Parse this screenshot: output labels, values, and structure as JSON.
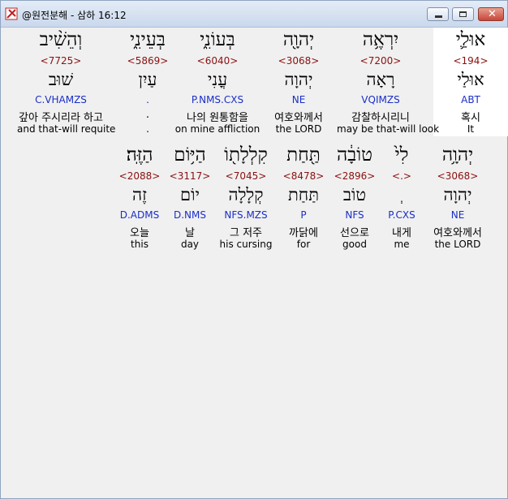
{
  "window": {
    "title": "@원전분해 - 삼하 16:12",
    "icon": "app-logo-icon",
    "controls": [
      "minimize-icon",
      "maximize-icon",
      "close-icon"
    ],
    "close_glyph": "✕"
  },
  "rows": [
    [
      {
        "heb": "אוּלַ֛י",
        "strong": "<194>",
        "lemma": "אוּלַי",
        "morph": "ABT",
        "kor": "혹시",
        "eng": "It",
        "highlight": true
      },
      {
        "heb": "יִרְאֶ֥ה",
        "strong": "<7200>",
        "lemma": "רָאָה",
        "morph": "VQIMZS",
        "kor": "감찰하시리니",
        "eng": "may be that-will look"
      },
      {
        "heb": "יְהוָ֖ה",
        "strong": "<3068>",
        "lemma": "יְהוָה",
        "morph": "NE",
        "kor": "여호와께서",
        "eng": "the LORD"
      },
      {
        "heb": "בְּעוֹנִ֑י",
        "strong": "<6040>",
        "lemma": "עֳנִי",
        "morph": "P.NMS.CXS",
        "kor": "나의 원통함을",
        "eng": "on mine affliction"
      },
      {
        "heb": "בְּעֵינִ֑י",
        "strong": "<5869>",
        "lemma": "עַיִן",
        "morph": ".",
        "kor": ".",
        "eng": "."
      },
      {
        "heb": "וְהֵשִׁ֨יב",
        "strong": "<7725>",
        "lemma": "שׁוּב",
        "morph": "C.VHAMZS",
        "kor": "갚아 주시리라 하고",
        "eng": "and that-will requite"
      }
    ],
    [
      {
        "heb": "יְהוָ֥ה",
        "strong": "<3068>",
        "lemma": "יְהוָה",
        "morph": "NE",
        "kor": "여호와께서",
        "eng": "the LORD"
      },
      {
        "heb": "לִי֙",
        "strong": "<.>",
        "lemma": "ְ",
        "morph": "P.CXS",
        "kor": "내게",
        "eng": "me"
      },
      {
        "heb": "טוֹבָ֔ה",
        "strong": "<2896>",
        "lemma": "טוֹב",
        "morph": "NFS",
        "kor": "선으로",
        "eng": "good"
      },
      {
        "heb": "תַּ֖חַת",
        "strong": "<8478>",
        "lemma": "תַּחַת",
        "morph": "P",
        "kor": "까닭에",
        "eng": "for"
      },
      {
        "heb": "קִלְלָת֖וֹ",
        "strong": "<7045>",
        "lemma": "קְלָלָה",
        "morph": "NFS.MZS",
        "kor": "그 저주",
        "eng": "his cursing"
      },
      {
        "heb": "הַיּ֥וֹם",
        "strong": "<3117>",
        "lemma": "יוֹם",
        "morph": "D.NMS",
        "kor": "날",
        "eng": "day"
      },
      {
        "heb": "הַזֶּֽה׃",
        "strong": "<2088>",
        "lemma": "זֶה",
        "morph": "D.ADMS",
        "kor": "오늘",
        "eng": "this"
      }
    ]
  ]
}
